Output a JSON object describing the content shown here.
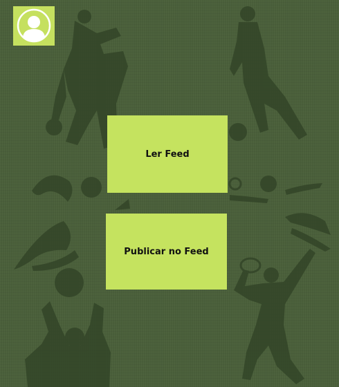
{
  "profile": {
    "avatar_icon": "user-avatar-icon",
    "background_color": "#c5e05f"
  },
  "actions": {
    "read_feed_label": "Ler Feed",
    "publish_feed_label": "Publicar no Feed",
    "button_color": "#c5e35f"
  },
  "background": {
    "color": "#4a5f3a",
    "artwork": "sports-silhouettes"
  }
}
